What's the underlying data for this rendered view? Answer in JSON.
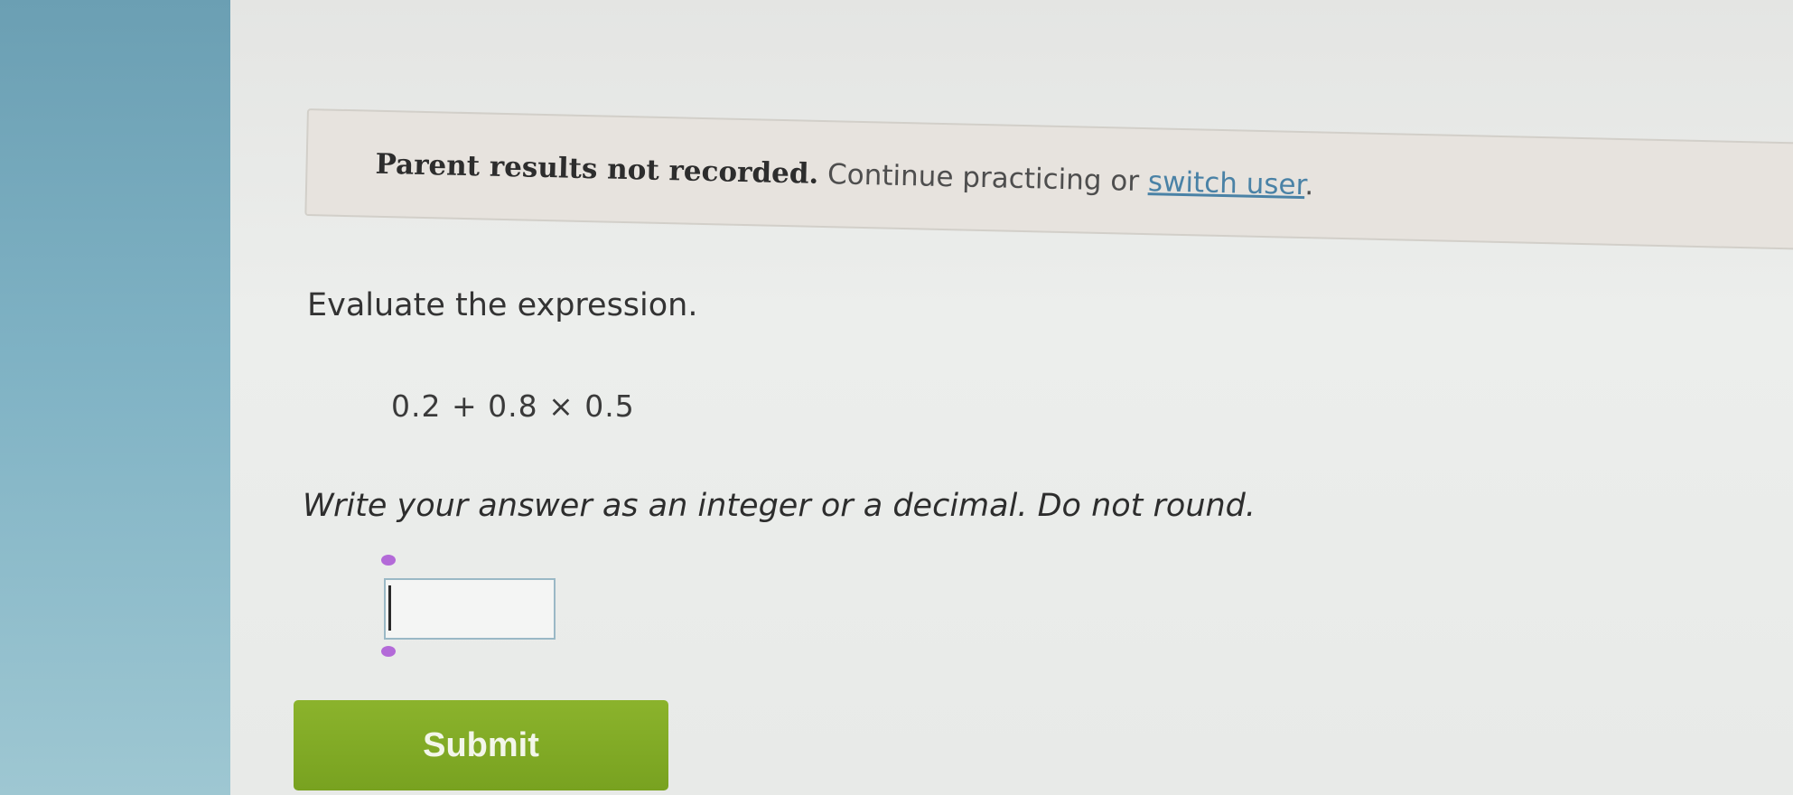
{
  "notice": {
    "strong_text": "Parent results not recorded.",
    "rest_text": " Continue practicing or ",
    "link_text": "switch user",
    "end_text": "."
  },
  "question": {
    "title": "Evaluate the expression.",
    "expression": "0.2 + 0.8 × 0.5",
    "instructions": "Write your answer as an integer or a decimal. Do not round."
  },
  "answer": {
    "value": ""
  },
  "submit": {
    "label": "Submit"
  },
  "colors": {
    "submit_green": "#7ba624",
    "link_blue": "#4a82a6",
    "handle_purple": "#b36ad8"
  }
}
